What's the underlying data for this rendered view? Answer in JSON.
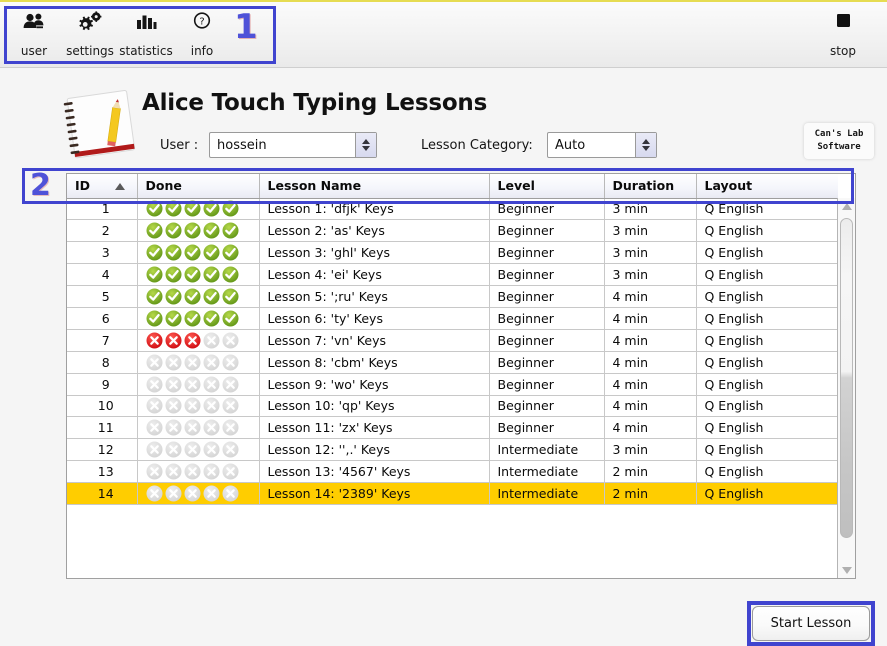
{
  "toolbar": {
    "items": [
      {
        "id": "user",
        "label": "user",
        "icon": "users-icon"
      },
      {
        "id": "settings",
        "label": "settings",
        "icon": "gears-icon"
      },
      {
        "id": "statistics",
        "label": "statistics",
        "icon": "bar-chart-icon"
      },
      {
        "id": "info",
        "label": "info",
        "icon": "question-circle-icon"
      }
    ],
    "stop": {
      "label": "stop",
      "icon": "stop-square-icon"
    }
  },
  "annotations": {
    "marker_1": "1",
    "marker_2": "2",
    "marker_color": "#4f52d8",
    "box_color": "#4044cf"
  },
  "header": {
    "title": "Alice Touch Typing Lessons",
    "logo_icon": "notebook-pencil-icon"
  },
  "controls": {
    "user_label": "User :",
    "user_value": "hossein",
    "category_label": "Lesson Category:",
    "category_value": "Auto"
  },
  "brand": {
    "line1": "Can's Lab",
    "line2": "Software"
  },
  "table": {
    "columns": [
      "ID",
      "Done",
      "Lesson Name",
      "Level",
      "Duration",
      "Layout"
    ],
    "sorted_column": "ID",
    "sort_direction": "ascending",
    "selected_row_id": "14",
    "selection_color": "#ffcd00",
    "status_colors": {
      "done": "#7cb02a",
      "failed": "#e8151c",
      "empty": "#dcdcdc"
    },
    "rows": [
      {
        "id": "1",
        "done": [
          "done",
          "done",
          "done",
          "done",
          "done"
        ],
        "name": "Lesson 1: 'dfjk' Keys",
        "level": "Beginner",
        "duration": "3 min",
        "layout": "Q English"
      },
      {
        "id": "2",
        "done": [
          "done",
          "done",
          "done",
          "done",
          "done"
        ],
        "name": "Lesson 2: 'as' Keys",
        "level": "Beginner",
        "duration": "3 min",
        "layout": "Q English"
      },
      {
        "id": "3",
        "done": [
          "done",
          "done",
          "done",
          "done",
          "done"
        ],
        "name": "Lesson 3: 'ghl' Keys",
        "level": "Beginner",
        "duration": "3 min",
        "layout": "Q English"
      },
      {
        "id": "4",
        "done": [
          "done",
          "done",
          "done",
          "done",
          "done"
        ],
        "name": "Lesson 4: 'ei' Keys",
        "level": "Beginner",
        "duration": "3 min",
        "layout": "Q English"
      },
      {
        "id": "5",
        "done": [
          "done",
          "done",
          "done",
          "done",
          "done"
        ],
        "name": "Lesson 5: ';ru' Keys",
        "level": "Beginner",
        "duration": "4 min",
        "layout": "Q English"
      },
      {
        "id": "6",
        "done": [
          "done",
          "done",
          "done",
          "done",
          "done"
        ],
        "name": "Lesson 6: 'ty' Keys",
        "level": "Beginner",
        "duration": "4 min",
        "layout": "Q English"
      },
      {
        "id": "7",
        "done": [
          "failed",
          "failed",
          "failed",
          "empty",
          "empty"
        ],
        "name": "Lesson 7: 'vn' Keys",
        "level": "Beginner",
        "duration": "4 min",
        "layout": "Q English"
      },
      {
        "id": "8",
        "done": [
          "empty",
          "empty",
          "empty",
          "empty",
          "empty"
        ],
        "name": "Lesson 8: 'cbm' Keys",
        "level": "Beginner",
        "duration": "4 min",
        "layout": "Q English"
      },
      {
        "id": "9",
        "done": [
          "empty",
          "empty",
          "empty",
          "empty",
          "empty"
        ],
        "name": "Lesson 9: 'wo' Keys",
        "level": "Beginner",
        "duration": "4 min",
        "layout": "Q English"
      },
      {
        "id": "10",
        "done": [
          "empty",
          "empty",
          "empty",
          "empty",
          "empty"
        ],
        "name": "Lesson 10: 'qp' Keys",
        "level": "Beginner",
        "duration": "4 min",
        "layout": "Q English"
      },
      {
        "id": "11",
        "done": [
          "empty",
          "empty",
          "empty",
          "empty",
          "empty"
        ],
        "name": "Lesson 11: 'zx' Keys",
        "level": "Beginner",
        "duration": "4 min",
        "layout": "Q English"
      },
      {
        "id": "12",
        "done": [
          "empty",
          "empty",
          "empty",
          "empty",
          "empty"
        ],
        "name": "Lesson 12: '',.' Keys",
        "level": "Intermediate",
        "duration": "3 min",
        "layout": "Q English"
      },
      {
        "id": "13",
        "done": [
          "empty",
          "empty",
          "empty",
          "empty",
          "empty"
        ],
        "name": "Lesson 13: '4567' Keys",
        "level": "Intermediate",
        "duration": "2 min",
        "layout": "Q English"
      },
      {
        "id": "14",
        "done": [
          "empty",
          "empty",
          "empty",
          "empty",
          "empty"
        ],
        "name": "Lesson 14: '2389' Keys",
        "level": "Intermediate",
        "duration": "2 min",
        "layout": "Q English"
      }
    ]
  },
  "footer": {
    "start_label": "Start Lesson"
  }
}
